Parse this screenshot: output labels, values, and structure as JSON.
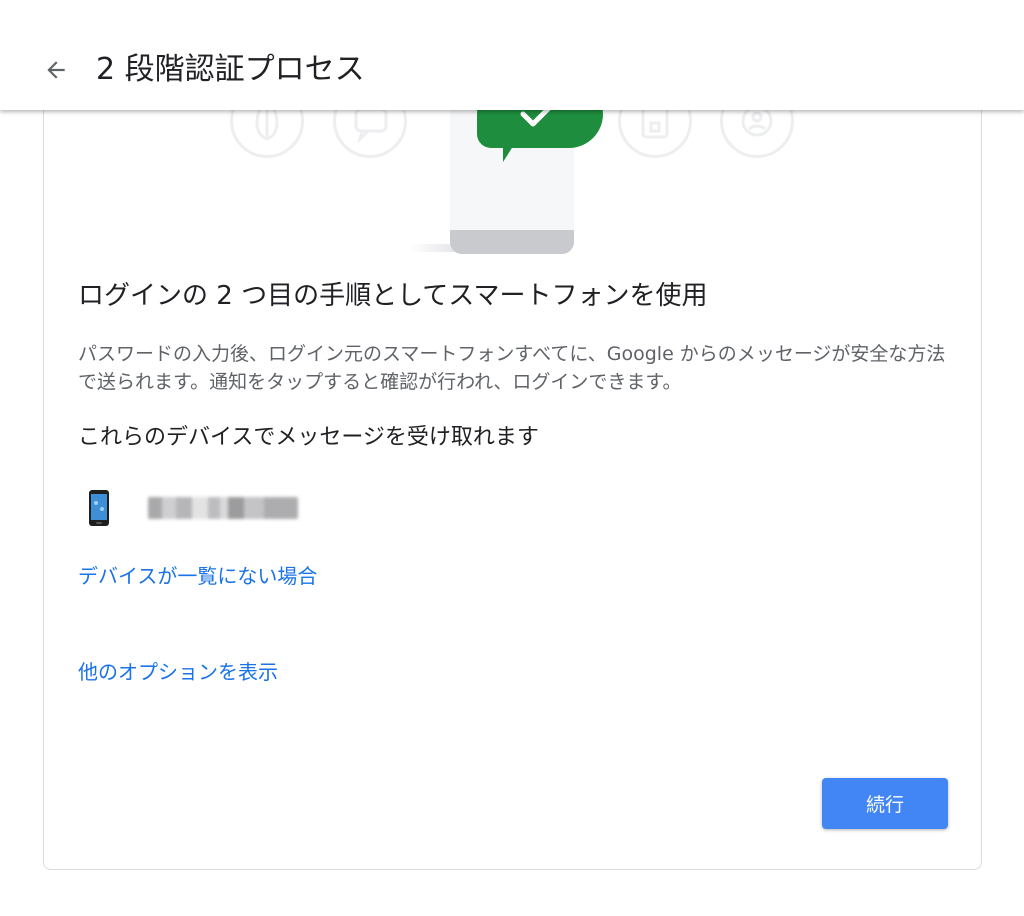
{
  "header": {
    "title": "2 段階認証プロセス",
    "back_icon": "arrow-back-icon"
  },
  "illustration": {
    "icons": [
      "shield-key-icon",
      "chat-icon",
      "smartphone-check-icon",
      "security-key-icon",
      "face-icon"
    ],
    "accent_color": "#1e8e3e"
  },
  "main": {
    "heading": "ログインの 2 つ目の手順としてスマートフォンを使用",
    "description": "パスワードの入力後、ログイン元のスマートフォンすべてに、Google からのメッセージが安全な方法で送られます。通知をタップすると確認が行われ、ログインできます。",
    "devices_heading": "これらのデバイスでメッセージを受け取れます",
    "device": {
      "icon": "smartphone-icon",
      "name_redacted": true
    },
    "link_devices_missing": "デバイスが一覧にない場合",
    "link_more_options": "他のオプションを表示",
    "continue_label": "続行"
  },
  "colors": {
    "link": "#1a73e8",
    "button": "#4285f4",
    "text_primary": "#202124",
    "text_secondary": "#5f6368"
  }
}
